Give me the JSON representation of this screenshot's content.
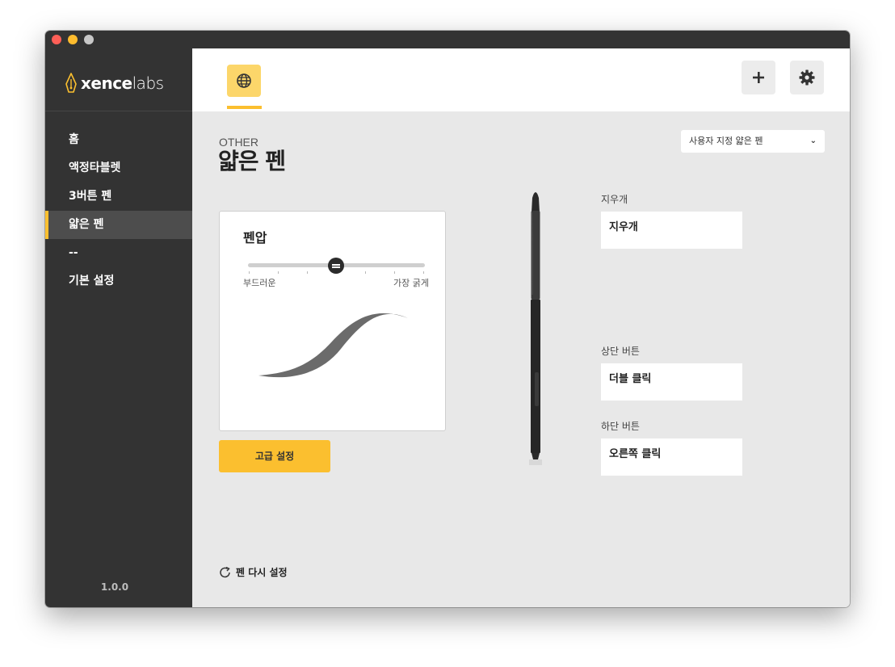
{
  "window": {
    "traffic_lights": [
      "close",
      "minimize",
      "zoom"
    ]
  },
  "logo": {
    "bold": "xence",
    "light": "labs",
    "accent": "#fbbf2f"
  },
  "sidebar": {
    "items": [
      {
        "label": "홈",
        "active": false
      },
      {
        "label": "액정타블렛",
        "active": false
      },
      {
        "label": "3버튼 펜",
        "active": false
      },
      {
        "label": "얇은 펜",
        "active": true
      },
      {
        "label": "--",
        "active": false
      },
      {
        "label": "기본 설정",
        "active": false
      }
    ],
    "version": "1.0.0"
  },
  "topbar": {
    "tab_icon": "globe-icon",
    "add_icon": "plus-icon",
    "settings_icon": "gear-icon"
  },
  "main": {
    "category": "OTHER",
    "title": "얇은 펜",
    "pen_select": {
      "value": "사용자 지정 얇은 펜"
    },
    "pressure": {
      "title": "펜압",
      "soft_label": "부드러운",
      "hard_label": "가장 굵게",
      "level": 0.5
    },
    "advanced_button": "고급 설정",
    "reset_label": "펜 다시 설정",
    "buttons": {
      "eraser": {
        "label": "지우개",
        "value": "지우개"
      },
      "upper": {
        "label": "상단 버튼",
        "value": "더블 클릭"
      },
      "lower": {
        "label": "하단 버튼",
        "value": "오른쪽 클릭"
      }
    }
  },
  "colors": {
    "sidebar_bg": "#333333",
    "accent": "#fbbf2f",
    "content_bg": "#e8e8e8"
  }
}
